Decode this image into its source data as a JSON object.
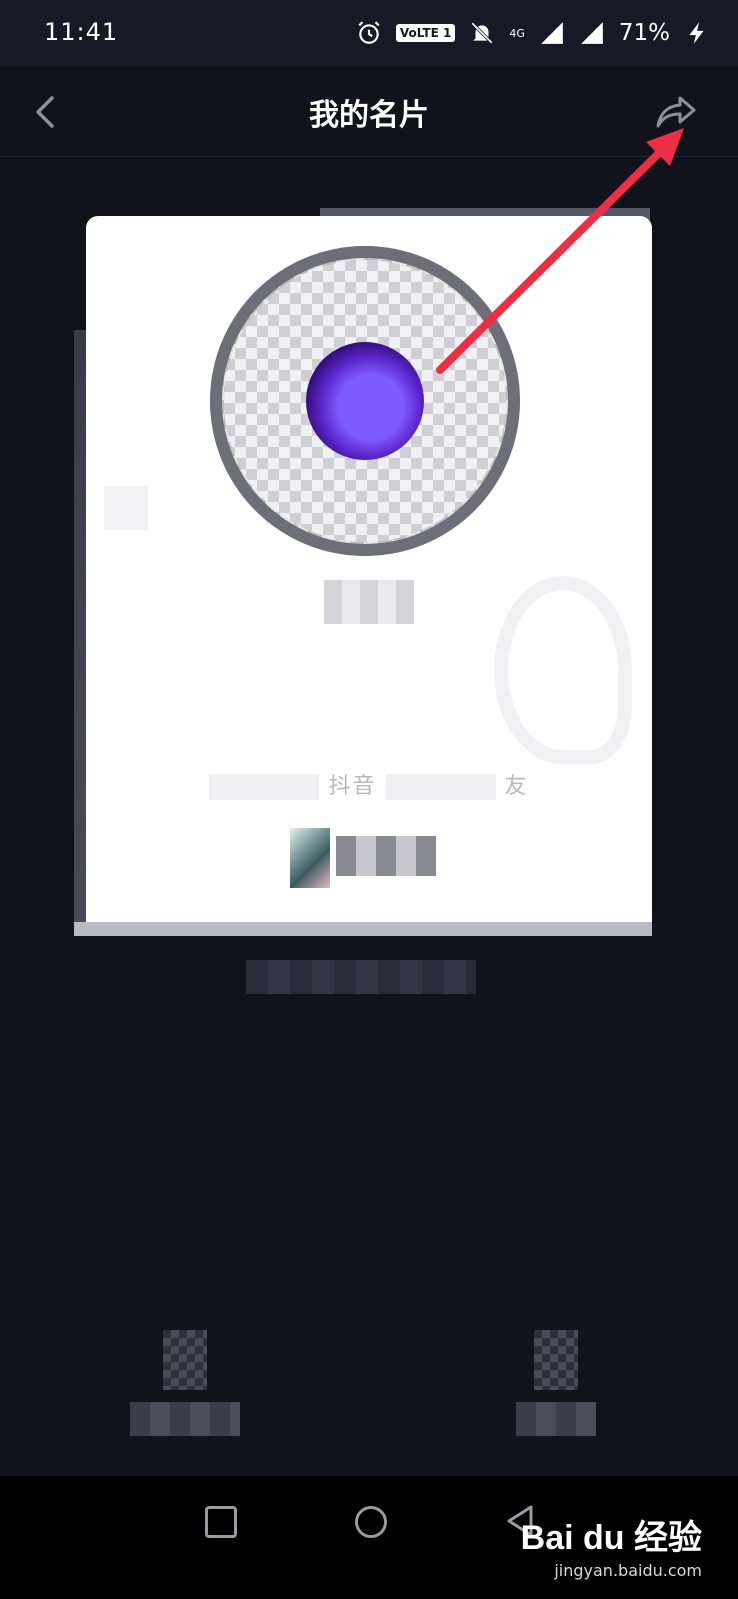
{
  "status_bar": {
    "time": "11:41",
    "volte_label": "VoLTE 1",
    "network_label": "4G",
    "battery": "71%"
  },
  "header": {
    "title": "我的名片"
  },
  "card": {
    "invite_text_char1": "抖音",
    "invite_text_char2": "友"
  },
  "watermark": {
    "main": "Bai du 经验",
    "sub": "jingyan.baidu.com"
  },
  "colors": {
    "background": "#12121d",
    "accent_arrow": "#ee2e45",
    "card": "#ffffff"
  }
}
